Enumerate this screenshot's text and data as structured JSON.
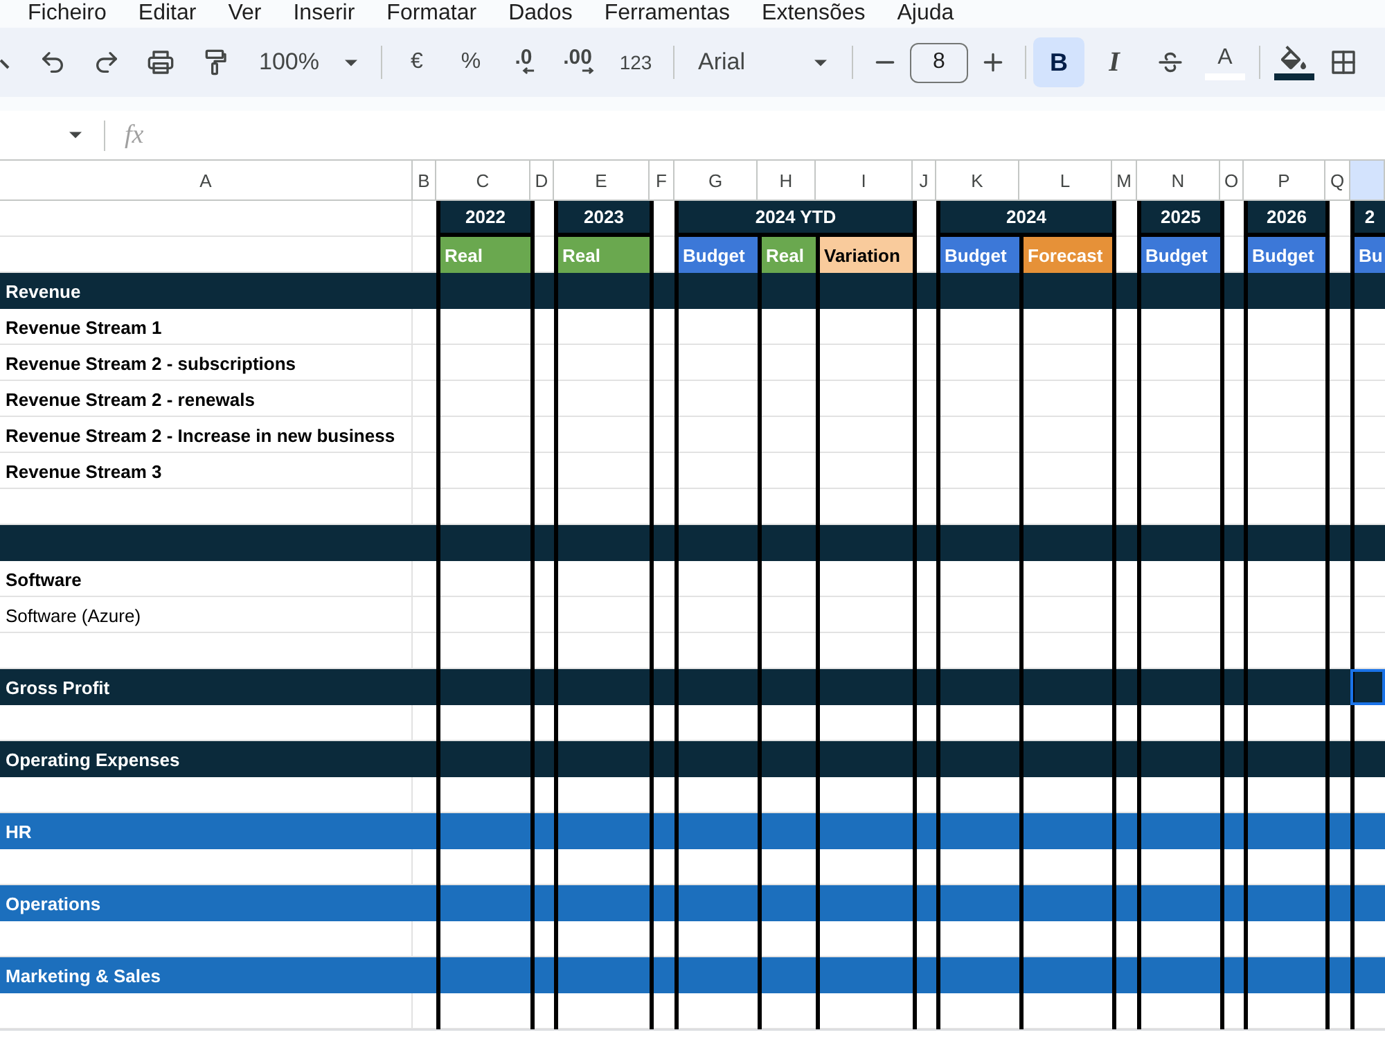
{
  "menu": [
    "Ficheiro",
    "Editar",
    "Ver",
    "Inserir",
    "Formatar",
    "Dados",
    "Ferramentas",
    "Extensões",
    "Ajuda"
  ],
  "toolbar": {
    "zoom": "100%",
    "currency": "€",
    "percent": "%",
    "decrease_decimals": ".0",
    "increase_decimals": ".00",
    "number_format": "123",
    "font": "Arial",
    "font_size": "8",
    "formatting": [
      {
        "kind": "bold",
        "label": "B",
        "on": true
      },
      {
        "kind": "italic",
        "label": "I",
        "on": false
      },
      {
        "kind": "strikethrough",
        "on": false
      },
      {
        "kind": "text_color",
        "label": "A",
        "color": "#ffffff"
      },
      {
        "kind": "fill_color",
        "color": "#0b2a3b"
      }
    ]
  },
  "formula_bar": {
    "label": "fx"
  },
  "columns": [
    {
      "letter": "A",
      "selected": false
    },
    {
      "letter": "B",
      "selected": false
    },
    {
      "letter": "C",
      "selected": false
    },
    {
      "letter": "D",
      "selected": false
    },
    {
      "letter": "E",
      "selected": false
    },
    {
      "letter": "F",
      "selected": false
    },
    {
      "letter": "G",
      "selected": false
    },
    {
      "letter": "H",
      "selected": false
    },
    {
      "letter": "I",
      "selected": false
    },
    {
      "letter": "J",
      "selected": false
    },
    {
      "letter": "K",
      "selected": false
    },
    {
      "letter": "L",
      "selected": false
    },
    {
      "letter": "M",
      "selected": false
    },
    {
      "letter": "N",
      "selected": false
    },
    {
      "letter": "O",
      "selected": false
    },
    {
      "letter": "P",
      "selected": false
    },
    {
      "letter": "Q",
      "selected": false
    },
    {
      "selected": true
    }
  ],
  "header_groups": [
    {
      "year": "2022",
      "columns": [
        {
          "label": "Real",
          "color": "#6aa84f"
        }
      ]
    },
    {
      "year": "2023",
      "columns": [
        {
          "label": "Real",
          "color": "#6aa84f"
        }
      ]
    },
    {
      "year": "2024 YTD",
      "columns": [
        {
          "label": "Budget",
          "color": "#3c78d8"
        },
        {
          "label": "Real",
          "color": "#6aa84f"
        },
        {
          "label": "Variation",
          "color": "#f9cb9c"
        }
      ]
    },
    {
      "year": "2024",
      "columns": [
        {
          "label": "Budget",
          "color": "#3c78d8"
        },
        {
          "label": "Forecast",
          "color": "#e69138"
        }
      ]
    },
    {
      "year": "2025",
      "columns": [
        {
          "label": "Budget",
          "color": "#3c78d8"
        }
      ]
    },
    {
      "year": "2026",
      "columns": [
        {
          "label": "Budget",
          "color": "#3c78d8"
        }
      ]
    },
    {
      "year": "2",
      "columns": [
        {
          "label": "Bu",
          "color": "#3c78d8"
        }
      ]
    }
  ],
  "rows": [
    {
      "kind": "section",
      "label": "Revenue",
      "active_cell": false
    },
    {
      "kind": "item",
      "label": "Revenue Stream 1",
      "bold": true,
      "active_cell": false
    },
    {
      "kind": "item",
      "label": "Revenue Stream 2 - subscriptions",
      "bold": true,
      "active_cell": false
    },
    {
      "kind": "item",
      "label": "Revenue Stream 2 - renewals",
      "bold": true,
      "active_cell": false
    },
    {
      "kind": "item",
      "label": "Revenue Stream 2 - Increase in new business",
      "bold": true,
      "active_cell": false
    },
    {
      "kind": "item",
      "label": "Revenue Stream 3",
      "bold": true,
      "active_cell": false
    },
    {
      "kind": "blank",
      "active_cell": false
    },
    {
      "kind": "section",
      "active_cell": false
    },
    {
      "kind": "item",
      "label": "Software",
      "bold": true,
      "active_cell": false
    },
    {
      "kind": "item",
      "label": "Software (Azure)",
      "bold": false,
      "active_cell": false
    },
    {
      "kind": "blank",
      "active_cell": false
    },
    {
      "kind": "section",
      "label": "Gross Profit",
      "active_cell": true
    },
    {
      "kind": "blank",
      "active_cell": false
    },
    {
      "kind": "section",
      "label": "Operating Expenses",
      "active_cell": false
    },
    {
      "kind": "blank",
      "active_cell": false
    },
    {
      "kind": "category",
      "label": "HR",
      "active_cell": false
    },
    {
      "kind": "blank",
      "active_cell": false
    },
    {
      "kind": "category",
      "label": "Operations",
      "active_cell": false
    },
    {
      "kind": "blank",
      "active_cell": false
    },
    {
      "kind": "category",
      "label": "Marketing & Sales",
      "active_cell": false
    },
    {
      "kind": "blank",
      "active_cell": false
    }
  ]
}
